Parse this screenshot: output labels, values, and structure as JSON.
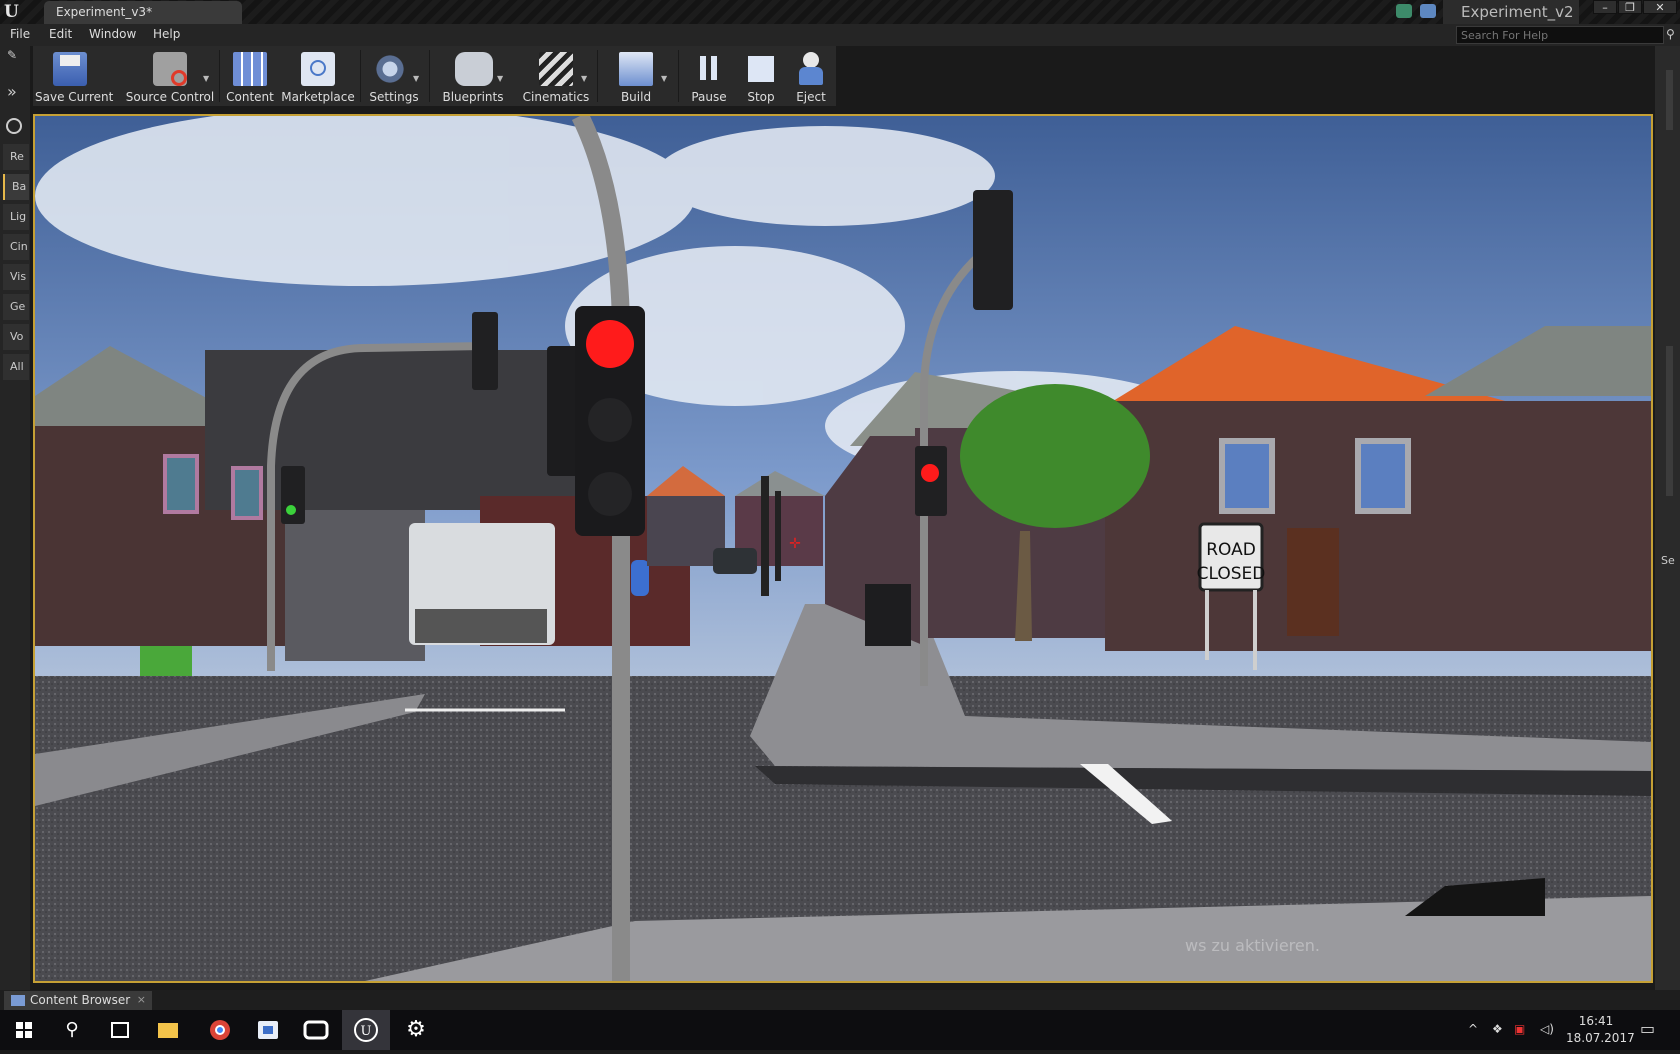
{
  "window": {
    "document_tab": "Experiment_v3*",
    "project_name": "Experiment_v2",
    "search_placeholder": "Search For Help"
  },
  "menu": [
    "File",
    "Edit",
    "Window",
    "Help"
  ],
  "left_rail": [
    "Re",
    "Ba",
    "Lig",
    "Cin",
    "Vis",
    "Ge",
    "Vo",
    "All"
  ],
  "toolbar": {
    "save_current": "Save Current",
    "source_control": "Source Control",
    "content": "Content",
    "marketplace": "Marketplace",
    "settings": "Settings",
    "blueprints": "Blueprints",
    "cinematics": "Cinematics",
    "build": "Build",
    "pause": "Pause",
    "stop": "Stop",
    "eject": "Eject"
  },
  "right_rail_label": "Se",
  "viewport": {
    "road_sign_line1": "ROAD",
    "road_sign_line2": "CLOSED",
    "watermark": "ws zu aktivieren."
  },
  "bottom": {
    "content_browser_tab": "Content Browser",
    "close_glyph": "×"
  },
  "taskbar": {
    "time": "16:41",
    "date": "18.07.2017"
  },
  "colors": {
    "accent": "#c5a035",
    "traffic_red": "#ff1b1b",
    "roof_orange": "#e0642a"
  }
}
